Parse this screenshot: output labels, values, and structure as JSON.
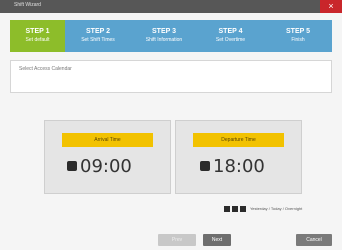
{
  "window": {
    "title": "Shift Wizard",
    "close_symbol": "×"
  },
  "steps": [
    {
      "number": "STEP 1",
      "label": "Set default"
    },
    {
      "number": "STEP 2",
      "label": "Set Shift Times"
    },
    {
      "number": "STEP 3",
      "label": "Shift Information"
    },
    {
      "number": "STEP 4",
      "label": "Set Overtime"
    },
    {
      "number": "STEP 5",
      "label": "Finish"
    }
  ],
  "description": "Select Access Calendar",
  "arrival": {
    "label": "Arrival Time",
    "time": "09:00"
  },
  "departure": {
    "label": "Departure Time",
    "time": "18:00"
  },
  "legend": {
    "text": "Yesterday / Today / Overnight"
  },
  "buttons": {
    "prev": "Prev",
    "next": "Next",
    "cancel": "Cancel"
  },
  "colors": {
    "active_step": "#8dbd2a",
    "step": "#5aa3cf",
    "label_bg": "#f2c200",
    "close": "#c9262b"
  }
}
